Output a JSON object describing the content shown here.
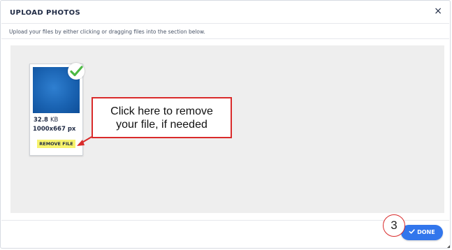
{
  "dialog": {
    "title": "UPLOAD PHOTOS",
    "close_icon": "×",
    "subtitle": "Upload your files by either clicking or dragging files into the section below."
  },
  "file": {
    "size_value": "32.8",
    "size_unit": "KB",
    "dimensions": "1000x667 px",
    "remove_label": "REMOVE FILE",
    "thumbnail_icon": "image-thumbnail",
    "status_icon": "checkmark-icon"
  },
  "callout": {
    "line1": "Click here to remove",
    "line2": "your file, if needed"
  },
  "step_marker": "3",
  "footer": {
    "done_label": "DONE",
    "done_icon": "checkmark-icon"
  },
  "colors": {
    "accent": "#3276ec",
    "highlight": "#f7f36d",
    "annotation": "#d92b2b",
    "success": "#4cb944"
  }
}
